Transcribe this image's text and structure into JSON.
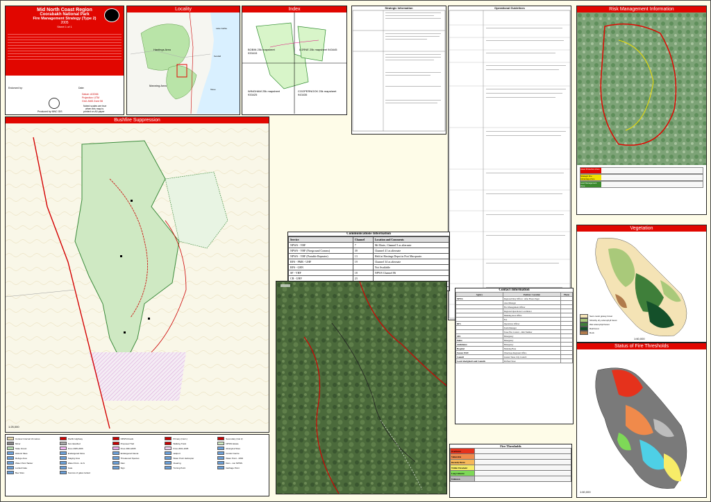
{
  "title_block": {
    "region": "Mid North Coast Region",
    "park": "Coorabakh National Park",
    "strategy": "Fire Management Strategy (Type 2)",
    "year": "2005",
    "sheet": "Sheet 1 of 1",
    "datum": "Datum: AGD66",
    "projection": "Projection: UTM",
    "grid": "Grid: AMG Zone 56",
    "scale_note1": "Noted scales are true",
    "scale_note2": "when this map is",
    "scale_note3": "printed on A0 paper",
    "produced_by": "Produced by MNC GIS",
    "endorsed_by": "Endorsed by:",
    "date_label": "Date:"
  },
  "panels": {
    "locality": "Locality",
    "index": "Index",
    "strategic_info": "Strategic Information",
    "operational_guidelines": "Operational Guidelines",
    "risk_management": "Risk Management Information",
    "bushfire_suppression": "Bushfire Suppression",
    "vegetation": "Vegetation",
    "fire_thresholds_status": "Status of Fire Thresholds",
    "fire_thresholds": "Fire Thresholds",
    "contact_info": "Contact Information",
    "communications": "Communications Information"
  },
  "locality_labels": [
    "Hastings Area",
    "Manning Area",
    "Lake Cathie",
    "Kendall",
    "Taree"
  ],
  "index_labels": [
    "BOBIN 25k mapsheet 933415",
    "LORNE 25k mapsheet 943445",
    "WINGHAM 25k mapsheet 933425",
    "COOPERNOOK 25k mapsheet 943435"
  ],
  "communications": {
    "headers": [
      "Service",
      "Channel",
      "Location and Comments"
    ],
    "rows": [
      [
        "NPWS - VHF",
        "7",
        "Mt Marie, Channel 9 as alternate"
      ],
      [
        "NPWS - VHF (Fireground Comms)",
        "39",
        "Channel 41 as alternate"
      ],
      [
        "NPWS - VHF (Portable Repeater)",
        "13",
        "Held at Hastings Depot in Port Macquarie."
      ],
      [
        "RFS - PMR - UHF",
        "19",
        "Channel 34 as alternate"
      ],
      [
        "RFS - GRN",
        "",
        "Not Available"
      ],
      [
        "SF - VHF",
        "18",
        "NPWS Channel 86"
      ],
      [
        "CB - UHF",
        "23",
        ""
      ],
      [
        "Aircraft - VHF",
        "",
        "Not Available"
      ],
      [
        "Mobile Phone - CDMA",
        "Yes",
        ""
      ],
      [
        "Mobile Phone - GSM",
        "Yes",
        ""
      ]
    ]
  },
  "contact": {
    "headers": [
      "Agency",
      "Position / Location",
      "Phone"
    ],
    "rows": [
      [
        "NPWS",
        "Regional Duty Officer / After Hours Pager",
        ""
      ],
      [
        "",
        "Area Manager",
        ""
      ],
      [
        "",
        "Fire Management Officer",
        ""
      ],
      [
        "",
        "Regional Operations Coordinator",
        ""
      ],
      [
        "",
        "Manning Area Office",
        ""
      ],
      [
        "",
        "Fax",
        ""
      ],
      [
        "RFS",
        "Operations Officer",
        ""
      ],
      [
        "",
        "Team Manager",
        ""
      ],
      [
        "",
        "Taree Fire Control - 24hr Number",
        ""
      ],
      [
        "SES",
        "Emergency",
        ""
      ],
      [
        "Police",
        "Emergency",
        ""
      ],
      [
        "Ambulance",
        "Emergency",
        ""
      ],
      [
        "Hospital",
        "Manning Base",
        ""
      ],
      [
        "Forests NSW",
        "Wauchope Regional Office",
        ""
      ],
      [
        "Council",
        "Greater Taree City Council",
        ""
      ],
      [
        "Local Aboriginal Land Councils",
        "Purfleet/Taree",
        ""
      ]
    ]
  },
  "fire_threshold_rows": [
    {
      "label": "Overburnt",
      "color": "#e5321c"
    },
    {
      "label": "Vulnerable",
      "color": "#f08a4b"
    },
    {
      "label": "Recently Burnt",
      "color": "#f6b85a"
    },
    {
      "label": "Within Threshold",
      "color": "#f7ec68"
    },
    {
      "label": "Long Unburnt",
      "color": "#7ed957"
    },
    {
      "label": "Unknown",
      "color": "#bdbdbd"
    }
  ],
  "vegetation_legend": [
    {
      "label": "Semi-moist grassy forest",
      "color": "#f4e3b5"
    },
    {
      "label": "Shrubby dry sclerophyll forest",
      "color": "#a9c97a"
    },
    {
      "label": "Wet sclerophyll forest",
      "color": "#3f7f3a"
    },
    {
      "label": "Rainforest",
      "color": "#14502a"
    },
    {
      "label": "Rock",
      "color": "#b07b4c"
    }
  ],
  "vegetation_scale": "1:60,000",
  "threshold_scale": "1:60,000",
  "suppression_scale": "1:25,000",
  "risk_table_rows": [
    "Asset Protection Zone",
    "Strategic Fire Advantage Zone",
    "Land Management Zone"
  ],
  "map_legend": [
    "Contour Interval 10 metres",
    "Pacific Highway",
    "NPWS Roads",
    "Primary (Cat 1)",
    "Secondary (Cat 2)",
    "Minor",
    "Not classified",
    "Proposed Trail",
    "Walking Track",
    "NPWS Estate",
    "State Forest",
    "Fires 2005-2006",
    "Fires 2004-2005",
    "Fires 2001-2005",
    "Aboriginal Sites",
    "Historic Sites",
    "Endangered Flora",
    "Endangered Fauna",
    "Heliport",
    "Control Centre",
    "Refuge Area",
    "Staging Area",
    "Threatened Species",
    "Water Point Helicopter",
    "Water Point - 4WD",
    "Water Point Tanker",
    "Water Point - Hi-S",
    "Dam",
    "Clearing",
    "Dam - non NPWS",
    "Locked Gate",
    "Gate",
    "Sign",
    "Turning Point",
    "Garbage Point",
    "Bee Sites",
    "Sources of gates locked"
  ]
}
